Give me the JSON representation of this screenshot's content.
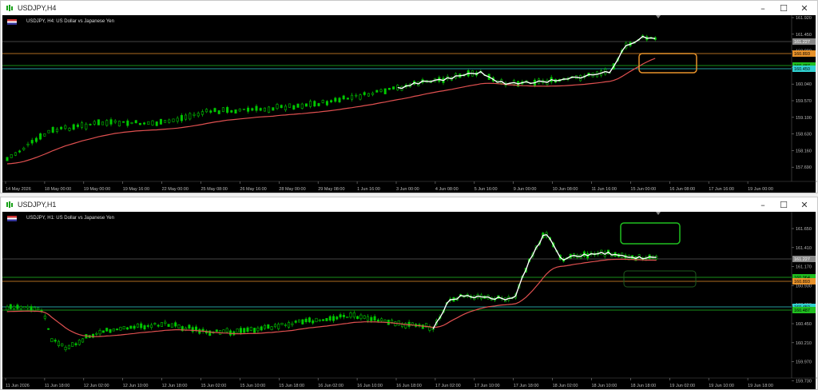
{
  "windows": [
    {
      "title": "USDJPY,H4",
      "chart_label": "USDJPY, H4:  US Dollar vs Japanese Yen",
      "price_labels": [
        "161.920",
        "161.450",
        "160.980",
        "160.510",
        "160.040",
        "159.570",
        "159.100",
        "158.630",
        "158.160",
        "157.690"
      ],
      "tags": {
        "bid": "161.227",
        "orange": "160.893",
        "green": "160.487",
        "cyan": "160.450"
      },
      "time_labels": [
        "14 May 2026",
        "18 May 00:00",
        "19 May 00:00",
        "19 May 16:00",
        "22 May 00:00",
        "25 May 08:00",
        "26 May 16:00",
        "28 May 00:00",
        "29 May 08:00",
        "1 Jun 16:00",
        "3 Jun 00:00",
        "4 Jun 08:00",
        "5 Jun 16:00",
        "9 Jun 00:00",
        "10 Jun 08:00",
        "11 Jun 16:00",
        "15 Jun 00:00",
        "16 Jun 08:00",
        "17 Jun 16:00",
        "19 Jun 00:00"
      ]
    },
    {
      "title": "USDJPY,H1",
      "chart_label": "USDJPY, H1:  US Dollar vs Japanese Yen",
      "price_labels": [
        "161.650",
        "161.410",
        "161.170",
        "160.930",
        "160.690",
        "160.450",
        "160.210",
        "159.970",
        "159.730"
      ],
      "tags": {
        "bid": "161.227",
        "green": "160.964",
        "orange": "160.893",
        "cyan": "160.450",
        "green2": "160.487"
      },
      "time_labels": [
        "11 Jun 2026",
        "11 Jun 18:00",
        "12 Jun 02:00",
        "12 Jun 10:00",
        "12 Jun 18:00",
        "15 Jun 02:00",
        "15 Jun 10:00",
        "15 Jun 18:00",
        "16 Jun 02:00",
        "16 Jun 10:00",
        "16 Jun 18:00",
        "17 Jun 02:00",
        "17 Jun 10:00",
        "17 Jun 18:00",
        "18 Jun 02:00",
        "18 Jun 10:00",
        "18 Jun 18:00",
        "19 Jun 02:00",
        "19 Jun 10:00",
        "19 Jun 18:00"
      ]
    }
  ],
  "colors": {
    "candle": "#00c800",
    "ma": "#e05050",
    "price_line": "#ffffff",
    "orange_line": "#e8922a",
    "green_line": "#20c020",
    "cyan_line": "#30d0d0",
    "grid": "#7a7a7a"
  }
}
